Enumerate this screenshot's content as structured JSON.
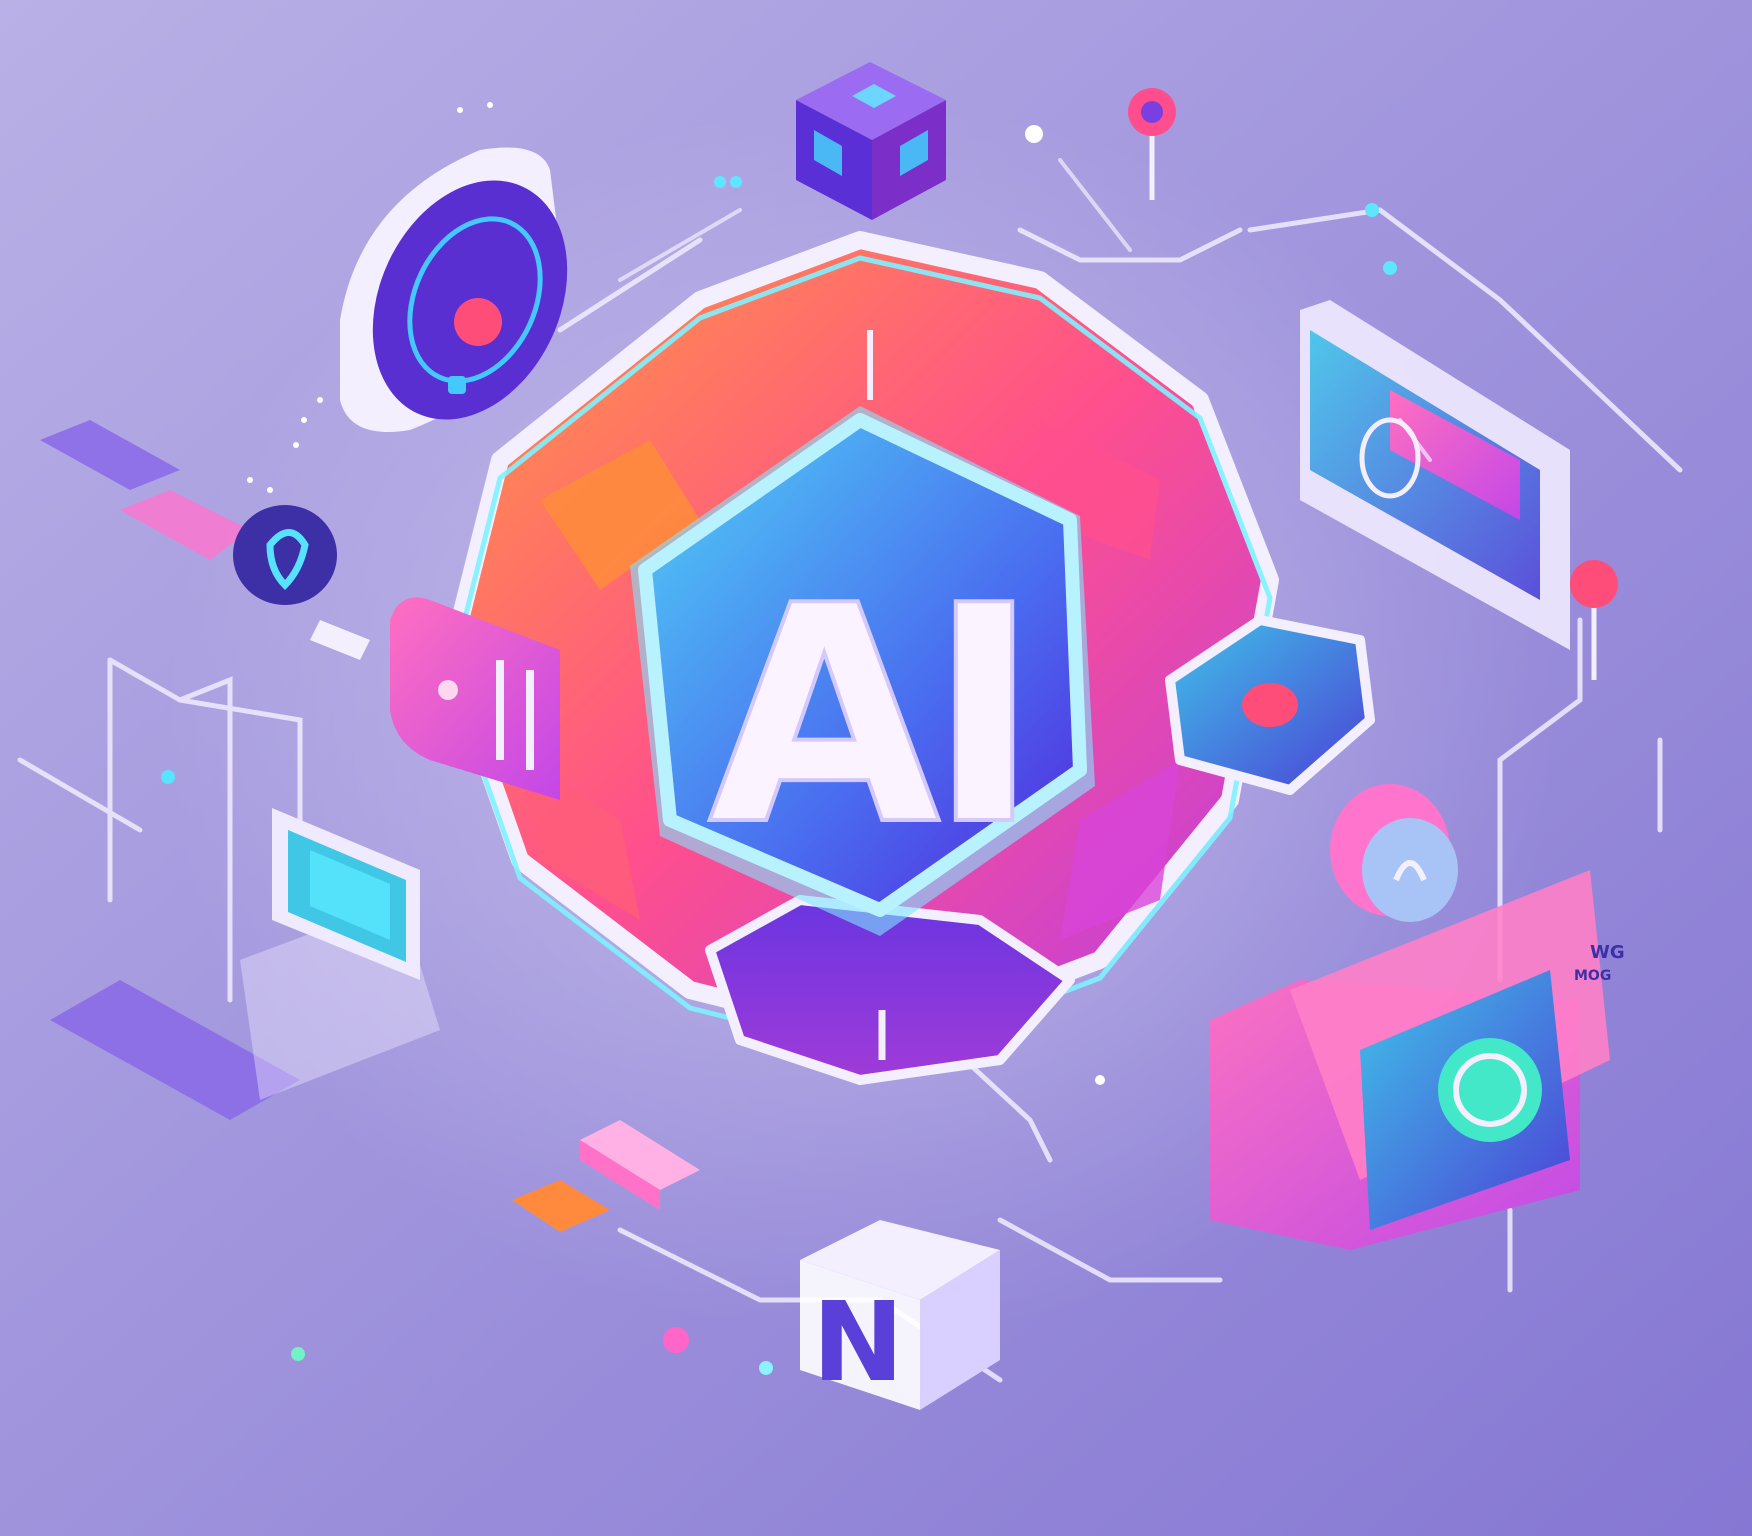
{
  "illustration": {
    "center_text": "AI",
    "bottom_glyph": "N",
    "right_panel_text_1": "WG",
    "right_panel_text_2": "MOG"
  },
  "colors": {
    "background_top": "#b7aee3",
    "background_bottom": "#8d7fd6",
    "hex_blue_light": "#43c6f2",
    "hex_blue_dark": "#4e2ee0",
    "orange": "#ff8a3d",
    "pink": "#ff4fa8",
    "purple": "#7a3ae0",
    "cyan_glow": "#7ef2ff",
    "white_outline": "#f4efff"
  },
  "icons": [
    "chip-cube-icon",
    "round-device-icon",
    "map-pin-icon",
    "shield-hexagon-icon",
    "monitor-screen-icon",
    "camera-device-icon",
    "circuit-line-icon"
  ]
}
